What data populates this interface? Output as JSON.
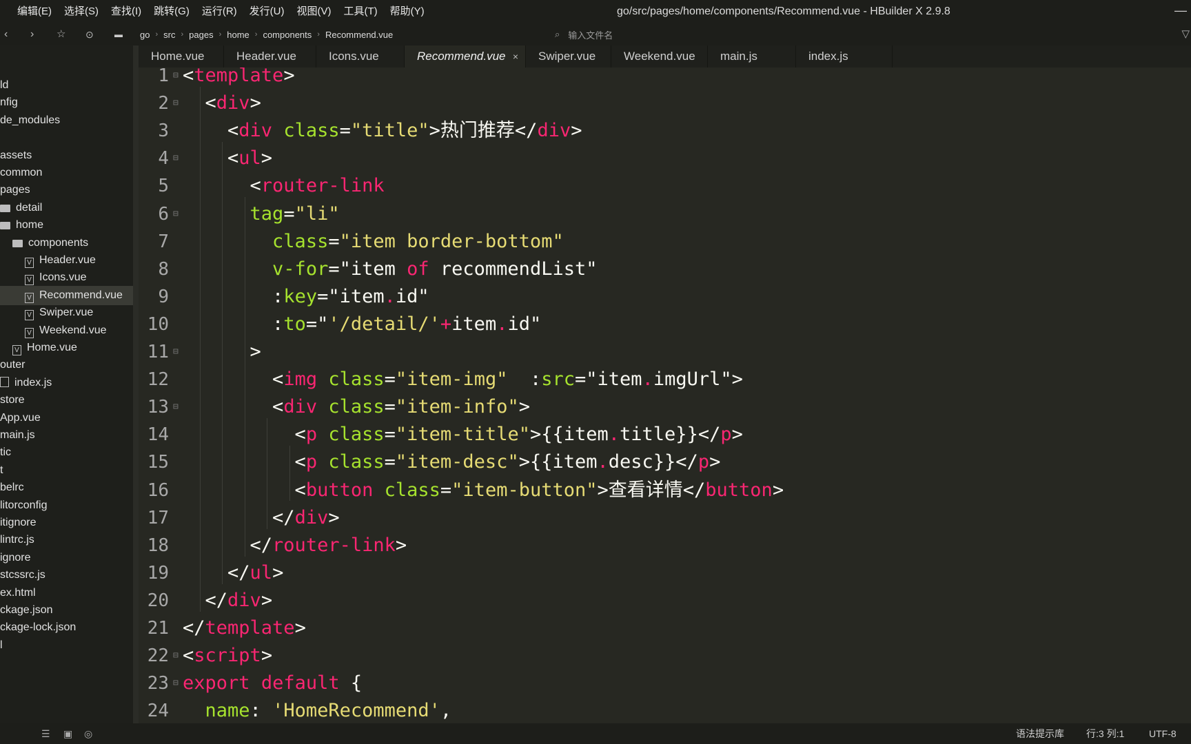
{
  "window": {
    "title": "go/src/pages/home/components/Recommend.vue - HBuilder X 2.9.8",
    "menu": [
      "编辑(E)",
      "选择(S)",
      "查找(I)",
      "跳转(G)",
      "运行(R)",
      "发行(U)",
      "视图(V)",
      "工具(T)",
      "帮助(Y)"
    ],
    "minimize_icon": "—"
  },
  "toolbar": {
    "breadcrumb": [
      "go",
      "src",
      "pages",
      "home",
      "components",
      "Recommend.vue"
    ],
    "file_search_placeholder": "输入文件名"
  },
  "sidebar": {
    "items": [
      {
        "label": "ld",
        "icon": "none",
        "active": false
      },
      {
        "label": "nfig",
        "icon": "none",
        "active": false
      },
      {
        "label": "de_modules",
        "icon": "none",
        "active": false
      },
      {
        "label": "",
        "icon": "none",
        "active": false
      },
      {
        "label": "assets",
        "icon": "none",
        "active": false
      },
      {
        "label": "common",
        "icon": "none",
        "active": false
      },
      {
        "label": "pages",
        "icon": "none",
        "active": false
      },
      {
        "label": "detail",
        "icon": "folder",
        "active": false
      },
      {
        "label": "home",
        "icon": "folder",
        "active": false
      },
      {
        "label": "components",
        "icon": "folder",
        "active": false
      },
      {
        "label": "Header.vue",
        "icon": "vue-file",
        "active": false
      },
      {
        "label": "Icons.vue",
        "icon": "vue-file",
        "active": false
      },
      {
        "label": "Recommend.vue",
        "icon": "vue-file",
        "active": true
      },
      {
        "label": "Swiper.vue",
        "icon": "vue-file",
        "active": false
      },
      {
        "label": "Weekend.vue",
        "icon": "vue-file",
        "active": false
      },
      {
        "label": "Home.vue",
        "icon": "vue-file",
        "active": false
      },
      {
        "label": "outer",
        "icon": "none",
        "active": false
      },
      {
        "label": "index.js",
        "icon": "file",
        "active": false
      },
      {
        "label": "store",
        "icon": "none",
        "active": false
      },
      {
        "label": "App.vue",
        "icon": "none",
        "active": false
      },
      {
        "label": "main.js",
        "icon": "none",
        "active": false
      },
      {
        "label": "tic",
        "icon": "none",
        "active": false
      },
      {
        "label": "t",
        "icon": "none",
        "active": false
      },
      {
        "label": "belrc",
        "icon": "none",
        "active": false
      },
      {
        "label": "litorconfig",
        "icon": "none",
        "active": false
      },
      {
        "label": "itignore",
        "icon": "none",
        "active": false
      },
      {
        "label": "lintrc.js",
        "icon": "none",
        "active": false
      },
      {
        "label": "ignore",
        "icon": "none",
        "active": false
      },
      {
        "label": "stcssrc.js",
        "icon": "none",
        "active": false
      },
      {
        "label": "ex.html",
        "icon": "none",
        "active": false
      },
      {
        "label": "ckage.json",
        "icon": "none",
        "active": false
      },
      {
        "label": "ckage-lock.json",
        "icon": "none",
        "active": false
      },
      {
        "label": "l",
        "icon": "none",
        "active": false
      }
    ]
  },
  "tabs": [
    {
      "label": "Home.vue",
      "active": false
    },
    {
      "label": "Header.vue",
      "active": false
    },
    {
      "label": "Icons.vue",
      "active": false
    },
    {
      "label": "Recommend.vue",
      "active": true,
      "close": "×"
    },
    {
      "label": "Swiper.vue",
      "active": false
    },
    {
      "label": "Weekend.vue",
      "active": false
    },
    {
      "label": "main.js",
      "active": false
    },
    {
      "label": "index.js",
      "active": false
    }
  ],
  "editor": {
    "lines": [
      {
        "n": "1",
        "fold": true,
        "tokens": [
          [
            "p",
            "<"
          ],
          [
            "t",
            "template"
          ],
          [
            "p",
            ">"
          ]
        ]
      },
      {
        "n": "2",
        "fold": true,
        "tokens": [
          [
            "p",
            "  <"
          ],
          [
            "t",
            "div"
          ],
          [
            "p",
            ">"
          ]
        ]
      },
      {
        "n": "3",
        "fold": false,
        "tokens": [
          [
            "p",
            "    <"
          ],
          [
            "t",
            "div"
          ],
          [
            "p",
            " "
          ],
          [
            "a",
            "class"
          ],
          [
            "p",
            "="
          ],
          [
            "s",
            "\"title\""
          ],
          [
            "p",
            ">热门推荐</"
          ],
          [
            "t",
            "div"
          ],
          [
            "p",
            ">"
          ]
        ]
      },
      {
        "n": "4",
        "fold": true,
        "tokens": [
          [
            "p",
            "    <"
          ],
          [
            "t",
            "ul"
          ],
          [
            "p",
            ">"
          ]
        ]
      },
      {
        "n": "5",
        "fold": false,
        "tokens": [
          [
            "p",
            "      <"
          ],
          [
            "t",
            "router-link"
          ]
        ]
      },
      {
        "n": "6",
        "fold": true,
        "tokens": [
          [
            "p",
            "      "
          ],
          [
            "a",
            "tag"
          ],
          [
            "p",
            "="
          ],
          [
            "s",
            "\"li\""
          ]
        ]
      },
      {
        "n": "7",
        "fold": false,
        "tokens": [
          [
            "p",
            "        "
          ],
          [
            "a",
            "class"
          ],
          [
            "p",
            "="
          ],
          [
            "s",
            "\"item border-bottom\""
          ]
        ]
      },
      {
        "n": "8",
        "fold": false,
        "tokens": [
          [
            "p",
            "        "
          ],
          [
            "a",
            "v-for"
          ],
          [
            "p",
            "=\"item "
          ],
          [
            "t",
            "of"
          ],
          [
            "p",
            " recommendList\""
          ]
        ]
      },
      {
        "n": "9",
        "fold": false,
        "tokens": [
          [
            "p",
            "        :"
          ],
          [
            "a",
            "key"
          ],
          [
            "p",
            "=\"item"
          ],
          [
            "t",
            "."
          ],
          [
            "p",
            "id\""
          ]
        ]
      },
      {
        "n": "10",
        "fold": false,
        "tokens": [
          [
            "p",
            "        :"
          ],
          [
            "a",
            "to"
          ],
          [
            "p",
            "=\""
          ],
          [
            "s",
            "'/detail/'"
          ],
          [
            "t",
            "+"
          ],
          [
            "p",
            "item"
          ],
          [
            "t",
            "."
          ],
          [
            "p",
            "id\""
          ]
        ]
      },
      {
        "n": "11",
        "fold": true,
        "tokens": [
          [
            "p",
            "      >"
          ]
        ]
      },
      {
        "n": "12",
        "fold": false,
        "tokens": [
          [
            "p",
            "        <"
          ],
          [
            "t",
            "img"
          ],
          [
            "p",
            " "
          ],
          [
            "a",
            "class"
          ],
          [
            "p",
            "="
          ],
          [
            "s",
            "\"item-img\""
          ],
          [
            "p",
            "  :"
          ],
          [
            "a",
            "src"
          ],
          [
            "p",
            "=\"item"
          ],
          [
            "t",
            "."
          ],
          [
            "p",
            "imgUrl\">"
          ]
        ]
      },
      {
        "n": "13",
        "fold": true,
        "tokens": [
          [
            "p",
            "        <"
          ],
          [
            "t",
            "div"
          ],
          [
            "p",
            " "
          ],
          [
            "a",
            "class"
          ],
          [
            "p",
            "="
          ],
          [
            "s",
            "\"item-info\""
          ],
          [
            "p",
            ">"
          ]
        ]
      },
      {
        "n": "14",
        "fold": false,
        "tokens": [
          [
            "p",
            "          <"
          ],
          [
            "t",
            "p"
          ],
          [
            "p",
            " "
          ],
          [
            "a",
            "class"
          ],
          [
            "p",
            "="
          ],
          [
            "s",
            "\"item-title\""
          ],
          [
            "p",
            ">{{item"
          ],
          [
            "t",
            "."
          ],
          [
            "p",
            "title}}</"
          ],
          [
            "t",
            "p"
          ],
          [
            "p",
            ">"
          ]
        ]
      },
      {
        "n": "15",
        "fold": false,
        "tokens": [
          [
            "p",
            "          <"
          ],
          [
            "t",
            "p"
          ],
          [
            "p",
            " "
          ],
          [
            "a",
            "class"
          ],
          [
            "p",
            "="
          ],
          [
            "s",
            "\"item-desc\""
          ],
          [
            "p",
            ">{{item"
          ],
          [
            "t",
            "."
          ],
          [
            "p",
            "desc}}</"
          ],
          [
            "t",
            "p"
          ],
          [
            "p",
            ">"
          ]
        ]
      },
      {
        "n": "16",
        "fold": false,
        "tokens": [
          [
            "p",
            "          <"
          ],
          [
            "t",
            "button"
          ],
          [
            "p",
            " "
          ],
          [
            "a",
            "class"
          ],
          [
            "p",
            "="
          ],
          [
            "s",
            "\"item-button\""
          ],
          [
            "p",
            ">查看详情</"
          ],
          [
            "t",
            "button"
          ],
          [
            "p",
            ">"
          ]
        ]
      },
      {
        "n": "17",
        "fold": false,
        "tokens": [
          [
            "p",
            "        </"
          ],
          [
            "t",
            "div"
          ],
          [
            "p",
            ">"
          ]
        ]
      },
      {
        "n": "18",
        "fold": false,
        "tokens": [
          [
            "p",
            "      </"
          ],
          [
            "t",
            "router-link"
          ],
          [
            "p",
            ">"
          ]
        ]
      },
      {
        "n": "19",
        "fold": false,
        "tokens": [
          [
            "p",
            "    </"
          ],
          [
            "t",
            "ul"
          ],
          [
            "p",
            ">"
          ]
        ]
      },
      {
        "n": "20",
        "fold": false,
        "tokens": [
          [
            "p",
            "  </"
          ],
          [
            "t",
            "div"
          ],
          [
            "p",
            ">"
          ]
        ]
      },
      {
        "n": "21",
        "fold": false,
        "tokens": [
          [
            "p",
            "</"
          ],
          [
            "t",
            "template"
          ],
          [
            "p",
            ">"
          ]
        ]
      },
      {
        "n": "22",
        "fold": true,
        "tokens": [
          [
            "p",
            "<"
          ],
          [
            "t",
            "script"
          ],
          [
            "p",
            ">"
          ]
        ]
      },
      {
        "n": "23",
        "fold": true,
        "tokens": [
          [
            "t",
            "export"
          ],
          [
            "p",
            " "
          ],
          [
            "t",
            "default"
          ],
          [
            "p",
            " {"
          ]
        ]
      },
      {
        "n": "24",
        "fold": false,
        "tokens": [
          [
            "p",
            "  "
          ],
          [
            "a",
            "name"
          ],
          [
            "p",
            ": "
          ],
          [
            "s",
            "'HomeRecommend'"
          ],
          [
            "p",
            ","
          ]
        ]
      }
    ]
  },
  "statusbar": {
    "syntax_lib": "语法提示库",
    "position": "行:3  列:1",
    "encoding": "UTF-8"
  },
  "colors": {
    "tag": "#f92672",
    "attr": "#a6e22e",
    "string": "#e6db74",
    "plain": "#f8f8f2",
    "background": "#272822"
  }
}
